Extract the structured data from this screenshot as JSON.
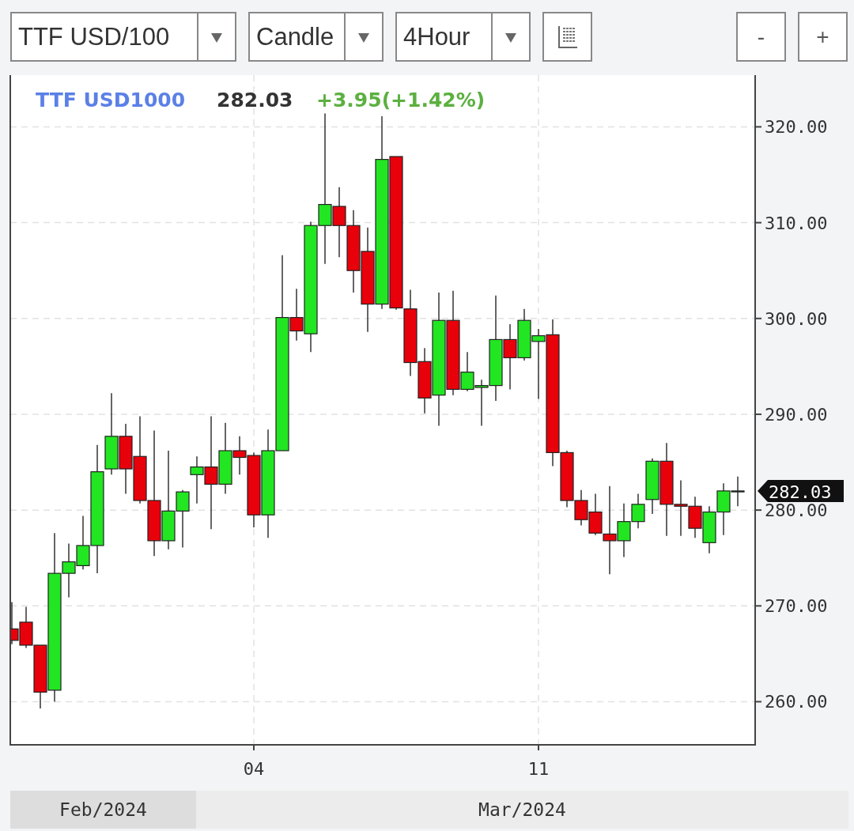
{
  "toolbar": {
    "instrument_select": {
      "value": "TTF USD/100"
    },
    "chart_type_select": {
      "value": "Candle"
    },
    "interval_select": {
      "value": "4Hour"
    },
    "zoom_out_label": "-",
    "zoom_in_label": "+"
  },
  "chart": {
    "legend": {
      "symbol": "TTF USD1000",
      "price": "282.03",
      "change": "+3.95(+1.42%)"
    },
    "price_marker": "282.03",
    "chart_data": {
      "type": "candlestick",
      "grid": true,
      "ylim": [
        255.5,
        325.4
      ],
      "yticks": [
        {
          "value": 260,
          "label": "260.00"
        },
        {
          "value": 270,
          "label": "270.00"
        },
        {
          "value": 280,
          "label": "280.00"
        },
        {
          "value": 290,
          "label": "290.00"
        },
        {
          "value": 300,
          "label": "300.00"
        },
        {
          "value": 310,
          "label": "310.00"
        },
        {
          "value": 320,
          "label": "320.00"
        }
      ],
      "categories": [
        null,
        null,
        null,
        null,
        null,
        null,
        null,
        null,
        null,
        null,
        null,
        null,
        null,
        null,
        null,
        null,
        null,
        "04",
        null,
        null,
        null,
        null,
        null,
        null,
        null,
        null,
        null,
        null,
        null,
        null,
        null,
        null,
        null,
        null,
        null,
        null,
        null,
        "11",
        null,
        null,
        null,
        null,
        null,
        null,
        null,
        null,
        null,
        null,
        null,
        null,
        null,
        null
      ],
      "ohlc": [
        [
          267.6,
          270.4,
          266.0,
          266.4
        ],
        [
          268.3,
          269.9,
          265.6,
          265.9
        ],
        [
          265.9,
          265.9,
          259.3,
          261.0
        ],
        [
          261.2,
          277.6,
          260.0,
          273.4
        ],
        [
          273.4,
          276.5,
          270.9,
          274.6
        ],
        [
          274.2,
          279.4,
          273.8,
          276.3
        ],
        [
          276.3,
          286.8,
          273.4,
          284.0
        ],
        [
          284.3,
          292.2,
          283.7,
          287.7
        ],
        [
          287.7,
          289.0,
          281.7,
          284.3
        ],
        [
          285.6,
          289.8,
          280.7,
          281.0
        ],
        [
          281.0,
          288.3,
          275.2,
          276.8
        ],
        [
          276.8,
          286.2,
          275.9,
          279.9
        ],
        [
          279.9,
          282.1,
          276.1,
          281.9
        ],
        [
          283.7,
          285.6,
          280.7,
          284.5
        ],
        [
          284.5,
          289.8,
          278.0,
          282.7
        ],
        [
          282.7,
          289.1,
          281.7,
          286.2
        ],
        [
          286.2,
          287.7,
          283.7,
          285.5
        ],
        [
          285.7,
          286.0,
          278.2,
          279.5
        ],
        [
          279.5,
          288.4,
          277.1,
          286.2
        ],
        [
          286.2,
          306.6,
          286.2,
          300.1
        ],
        [
          300.1,
          303.1,
          297.7,
          298.7
        ],
        [
          298.4,
          310.1,
          296.5,
          309.7
        ],
        [
          309.7,
          321.4,
          305.7,
          311.9
        ],
        [
          311.7,
          313.7,
          306.4,
          309.7
        ],
        [
          309.7,
          311.3,
          302.7,
          305.0
        ],
        [
          307.0,
          309.5,
          298.6,
          301.5
        ],
        [
          301.5,
          321.1,
          301.0,
          316.6
        ],
        [
          316.9,
          316.9,
          300.9,
          301.1
        ],
        [
          301.0,
          303.0,
          294.0,
          295.4
        ],
        [
          295.5,
          296.9,
          290.1,
          291.7
        ],
        [
          292.0,
          302.7,
          288.8,
          299.8
        ],
        [
          299.8,
          302.9,
          292.0,
          292.6
        ],
        [
          292.6,
          296.5,
          292.4,
          294.4
        ],
        [
          292.8,
          293.6,
          288.8,
          293.0
        ],
        [
          293.0,
          302.4,
          291.4,
          297.8
        ],
        [
          297.8,
          299.4,
          292.6,
          295.9
        ],
        [
          295.9,
          301.0,
          295.6,
          299.8
        ],
        [
          297.6,
          298.9,
          291.6,
          298.2
        ],
        [
          298.3,
          299.9,
          284.6,
          286.0
        ],
        [
          286.0,
          286.2,
          280.3,
          281.0
        ],
        [
          281.0,
          282.1,
          278.4,
          279.0
        ],
        [
          279.8,
          281.7,
          277.4,
          277.6
        ],
        [
          277.5,
          282.5,
          273.3,
          276.8
        ],
        [
          276.8,
          280.7,
          275.1,
          278.8
        ],
        [
          278.8,
          281.7,
          278.1,
          280.6
        ],
        [
          281.1,
          285.4,
          279.6,
          285.1
        ],
        [
          285.1,
          287.0,
          277.3,
          280.6
        ],
        [
          280.6,
          283.1,
          277.3,
          280.4
        ],
        [
          280.4,
          281.4,
          277.1,
          278.1
        ],
        [
          276.6,
          280.4,
          275.5,
          279.8
        ],
        [
          279.8,
          282.8,
          277.4,
          282.0
        ],
        [
          281.9,
          283.5,
          280.4,
          282.0
        ]
      ]
    },
    "time_bar": [
      {
        "label": "Feb/2024",
        "selected": true
      },
      {
        "label": "Mar/2024",
        "selected": false
      }
    ]
  }
}
